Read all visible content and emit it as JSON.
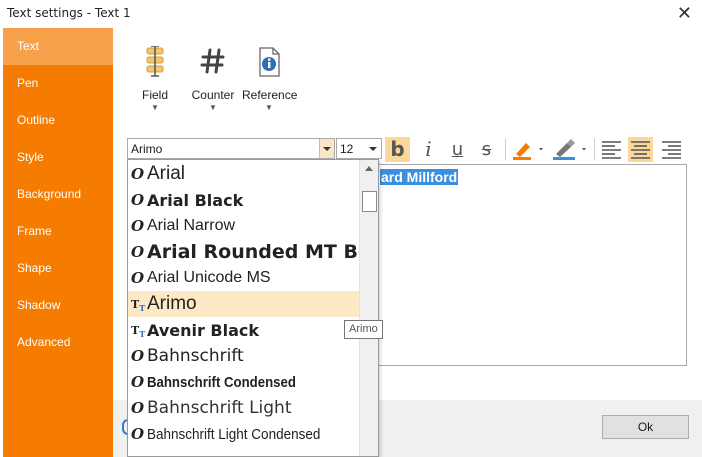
{
  "window": {
    "title": "Text settings - Text 1",
    "close_glyph": "✕"
  },
  "sidebar": {
    "items": [
      {
        "label": "Text",
        "active": true
      },
      {
        "label": "Pen"
      },
      {
        "label": "Outline"
      },
      {
        "label": "Style"
      },
      {
        "label": "Background"
      },
      {
        "label": "Frame"
      },
      {
        "label": "Shape"
      },
      {
        "label": "Shadow"
      },
      {
        "label": "Advanced"
      }
    ]
  },
  "insert_tools": [
    {
      "label": "Field",
      "icon": "field-icon"
    },
    {
      "label": "Counter",
      "icon": "hash-icon"
    },
    {
      "label": "Reference",
      "icon": "reference-icon"
    }
  ],
  "format_toolbar": {
    "font_name": "Arimo",
    "font_size": "12",
    "bold_glyph": "b",
    "italic_glyph": "i",
    "underline_glyph": "u",
    "strike_glyph": "s",
    "colors": {
      "highlight": "#f57c00",
      "text_color": "#3a8fde"
    }
  },
  "editor": {
    "selected_text": "ard Millford"
  },
  "font_list": {
    "items": [
      {
        "name": "Arial",
        "type": "opentype",
        "family": "Liberation Sans",
        "size": 19,
        "weight": "normal"
      },
      {
        "name": "Arial Black",
        "type": "opentype",
        "family": "DejaVu Sans",
        "size": 16,
        "weight": "bold"
      },
      {
        "name": "Arial Narrow",
        "type": "opentype",
        "family": "Liberation Sans",
        "size": 16,
        "weight": "normal"
      },
      {
        "name": "Arial Rounded MT Bo",
        "type": "opentype",
        "family": "DejaVu Sans",
        "size": 19,
        "weight": "bold"
      },
      {
        "name": "Arial Unicode MS",
        "type": "opentype",
        "family": "Liberation Sans",
        "size": 16,
        "weight": "normal"
      },
      {
        "name": "Arimo",
        "type": "truetype",
        "family": "Liberation Sans",
        "size": 19,
        "weight": "normal",
        "highlighted": true
      },
      {
        "name": "Avenir Black",
        "type": "truetype",
        "family": "DejaVu Sans",
        "size": 16,
        "weight": "bold"
      },
      {
        "name": "Bahnschrift",
        "type": "opentype",
        "family": "DejaVu Sans",
        "size": 17,
        "weight": "normal"
      },
      {
        "name": "Bahnschrift Condensed",
        "type": "opentype",
        "family": "Liberation Sans",
        "size": 15,
        "weight": "bold"
      },
      {
        "name": "Bahnschrift Light",
        "type": "opentype",
        "family": "DejaVu Sans",
        "size": 17,
        "weight": "normal"
      },
      {
        "name": "Bahnschrift Light Condensed",
        "type": "opentype",
        "family": "Liberation Sans",
        "size": 15,
        "weight": "normal"
      }
    ],
    "tooltip": "Arimo"
  },
  "footer": {
    "ok_label": "Ok"
  },
  "colors": {
    "sidebar_bg": "#f57c00",
    "sidebar_active": "#f7a14a",
    "selection": "#3a8fde"
  }
}
